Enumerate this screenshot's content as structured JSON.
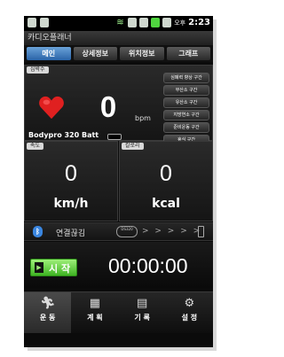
{
  "statusbar": {
    "ampm": "오후",
    "time": "2:23"
  },
  "app": {
    "title": "카디오플래너"
  },
  "tabs": [
    {
      "label": "메인"
    },
    {
      "label": "상세정보"
    },
    {
      "label": "위치정보"
    },
    {
      "label": "그래프"
    }
  ],
  "heart_rate": {
    "label": "심박수",
    "value": "0",
    "unit": "bpm",
    "zones": [
      "심폐력 향상 구간",
      "무산소 구간",
      "유산소 구간",
      "지방연소 구간",
      "준비운동 구간",
      "휴식 구간"
    ],
    "device_battery_label": "Bodypro 320 Batt"
  },
  "speed": {
    "label": "속도",
    "value": "0",
    "unit": "km/h"
  },
  "calories": {
    "label": "칼로리",
    "value": "0",
    "unit": "kcal"
  },
  "connection": {
    "status": "연결끊김",
    "device_code": "DS320",
    "arrows": "> > > > >"
  },
  "control": {
    "start_label": "시 작",
    "timer": "00:00:00"
  },
  "bottom_nav": [
    {
      "label": "운 동",
      "icon": "run-icon"
    },
    {
      "label": "계 획",
      "icon": "plan-icon"
    },
    {
      "label": "기 록",
      "icon": "record-icon"
    },
    {
      "label": "설 정",
      "icon": "settings-icon"
    }
  ],
  "colors": {
    "active_tab": "#2a64a8",
    "start_button": "#3fb423",
    "heart": "#e02020",
    "bluetooth": "#3a86e0"
  }
}
